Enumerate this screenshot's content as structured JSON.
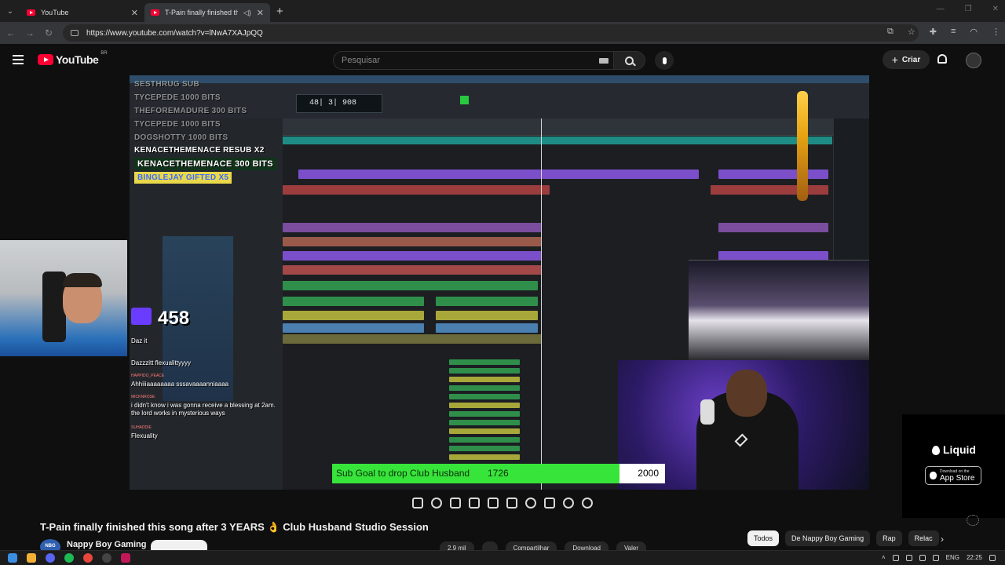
{
  "browser": {
    "tabs": [
      {
        "title": "YouTube",
        "active": false
      },
      {
        "title": "T-Pain finally finished this so",
        "active": true
      }
    ],
    "url": "https://www.youtube.com/watch?v=lNwA7XAJpQQ"
  },
  "youtube_header": {
    "logo_text": "YouTube",
    "country_code": "BR",
    "search_placeholder": "Pesquisar",
    "create_label": "Criar"
  },
  "stream_overlay": {
    "alerts": [
      "SESTHRUG  SUB",
      "TYCEPEDE  1000 BITS",
      "THEFOREMADURE  300 BITS",
      "TYCEPEDE  1000 BITS",
      "DOGSHOTTY  1000 BITS",
      "KENACETHEMENACE  RESUB X2",
      "KENACETHEMENACE  300 BITS",
      "BINGLEJAY  GIFTED X5"
    ],
    "counter": "458",
    "daw_time": "48| 3| 908",
    "chat": [
      {
        "name": "",
        "text": "Daz it"
      },
      {
        "name": "",
        "text": "Dazzzitt flexualittyyyy"
      },
      {
        "name": "HAPPIDO_PEACE",
        "text": "Ahhiiiaaaaaaaa sssavaaaanniaaaa"
      },
      {
        "name": "MICKNROSE",
        "text": "i didn't know i was gonna receive a blessing at 2am. the lord works in mysterious ways"
      },
      {
        "name": "SUHADDIE",
        "text": "Flexuality"
      }
    ],
    "sub_goal": {
      "label": "Sub Goal to drop Club Husband",
      "current": "1726",
      "target": "2000",
      "progress": 0.863
    }
  },
  "ad": {
    "brand": "Liquid",
    "store_small": "Download on the",
    "store_big": "App Store"
  },
  "video": {
    "title": "T-Pain finally finished this song after 3 YEARS 👌 Club Husband Studio Session",
    "channel_name": "Nappy Boy Gaming",
    "channel_avatar": "NBG",
    "actions": [
      "2,9 mil",
      "",
      "Compartilhar",
      "Download",
      "Valer"
    ]
  },
  "chips": [
    "Todos",
    "De Nappy Boy Gaming",
    "Rap",
    "Relac"
  ],
  "taskbar": {
    "language": "ENG",
    "time": "22:25"
  }
}
